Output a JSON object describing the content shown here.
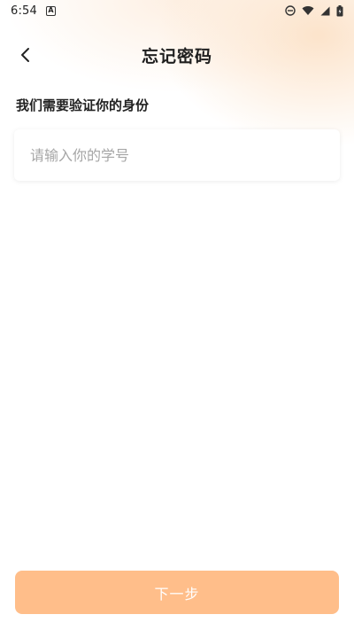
{
  "status_bar": {
    "time": "6:54",
    "notification_icon_label": "A"
  },
  "header": {
    "title": "忘记密码"
  },
  "form": {
    "section_label": "我们需要验证你的身份",
    "student_id_value": "",
    "student_id_placeholder": "请输入你的学号"
  },
  "footer": {
    "next_label": "下一步"
  },
  "colors": {
    "accent": "#ffbe8a",
    "glow": "#fce2c8"
  }
}
